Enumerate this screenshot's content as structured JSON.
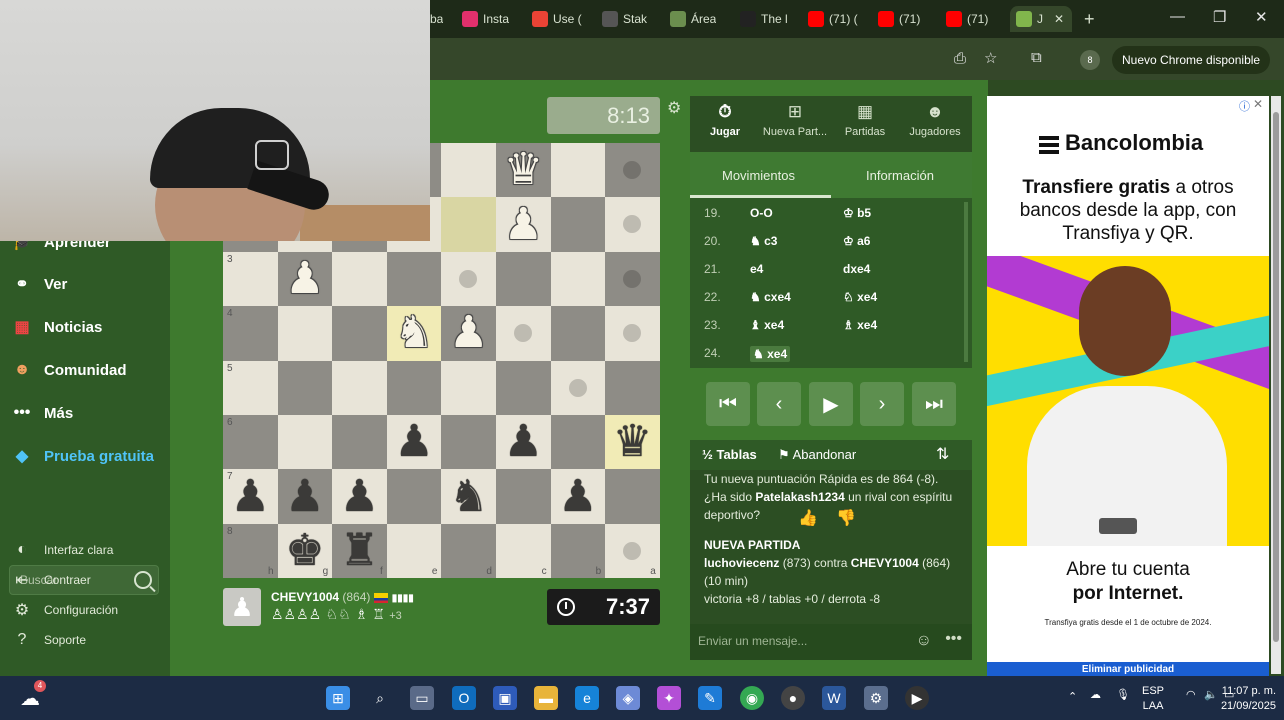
{
  "browser": {
    "tabs": [
      {
        "label": "Insta",
        "color": "#e1306c"
      },
      {
        "label": "Use (",
        "color": "#ea4335"
      },
      {
        "label": "Stak",
        "color": "#555555"
      },
      {
        "label": "Área",
        "color": "#6b8e4e"
      },
      {
        "label": "The l",
        "color": "#222222"
      },
      {
        "label": "(71) (",
        "color": "#ff0000"
      },
      {
        "label": "(71)",
        "color": "#ff0000"
      },
      {
        "label": "(71)",
        "color": "#ff0000"
      },
      {
        "label": "J",
        "color": "#81b64c"
      }
    ],
    "update_label": "Nuevo Chrome disponible",
    "profile_badge": "8"
  },
  "sidebar": {
    "items": [
      {
        "label": "Aprender",
        "icon": "grad-cap-icon"
      },
      {
        "label": "Ver",
        "icon": "binoculars-icon"
      },
      {
        "label": "Noticias",
        "icon": "news-icon"
      },
      {
        "label": "Comunidad",
        "icon": "people-icon"
      },
      {
        "label": "Más",
        "icon": "dots-icon"
      }
    ],
    "trial_label": "Prueba gratuita",
    "search_placeholder": "Buscar",
    "footer": [
      {
        "label": "Interfaz clara"
      },
      {
        "label": "Contraer"
      },
      {
        "label": "Configuración"
      },
      {
        "label": "Soporte"
      }
    ]
  },
  "game": {
    "top_clock": "8:13",
    "bottom_clock": "7:37",
    "player_name": "CHEVY1004",
    "player_rating": "(864)",
    "player_pieces": "♙♙♙♙ ♘♘ ♗ ♖",
    "material_diff": "+3",
    "ranks": [
      "3",
      "4",
      "5",
      "6",
      "7",
      "8"
    ],
    "files": [
      "h",
      "g",
      "f",
      "e",
      "d",
      "c",
      "b",
      "a"
    ]
  },
  "panel": {
    "tabs": [
      {
        "label": "Jugar",
        "icon": "stopwatch-icon"
      },
      {
        "label": "Nueva Part...",
        "icon": "plus-square-icon"
      },
      {
        "label": "Partidas",
        "icon": "grid-icon"
      },
      {
        "label": "Jugadores",
        "icon": "players-icon"
      }
    ],
    "subtabs": [
      "Movimientos",
      "Información"
    ],
    "moves": [
      {
        "num": "19.",
        "w": "O-O",
        "b": "♔ b5"
      },
      {
        "num": "20.",
        "w": "♞ c3",
        "b": "♔ a6"
      },
      {
        "num": "21.",
        "w": "e4",
        "b": "dxe4"
      },
      {
        "num": "22.",
        "w": "♞ cxe4",
        "b": "♘ xe4"
      },
      {
        "num": "23.",
        "w": "♝ xe4",
        "b": "♗ xe4"
      },
      {
        "num": "24.",
        "w": "♞ xe4",
        "b": ""
      }
    ],
    "actions": {
      "tables": "Tablas",
      "resign": "Abandonar",
      "half": "½"
    },
    "chat": {
      "line1": "Tu nueva puntuación Rápida es de 864 (-8).",
      "line2_a": "¿Ha sido ",
      "line2_name": "Patelakash1234",
      "line2_b": " un rival con espíritu deportivo?",
      "new_game": "NUEVA PARTIDA",
      "players_a": "luchoviecenz",
      "players_mid": " (873) contra ",
      "players_b": "CHEVY1004",
      "players_tail": " (864) (10 min)",
      "result": "victoria +8 / tablas +0 / derrota -8"
    },
    "chat_placeholder": "Enviar un mensaje..."
  },
  "ad": {
    "brand": "Bancolombia",
    "headline_bold": "Transfiere gratis",
    "headline_rest": " a otros bancos desde la app, con Transfiya y QR.",
    "cta_a": "Abre tu cuenta",
    "cta_b": "por Internet.",
    "fine_print": "Transfiya gratis desde el 1 de octubre de 2024.",
    "remove": "Eliminar publicidad"
  },
  "taskbar": {
    "lang1": "ESP",
    "lang2": "LAA",
    "time": "11:07 p. m.",
    "date": "21/09/2025",
    "weather_badge": "4"
  }
}
